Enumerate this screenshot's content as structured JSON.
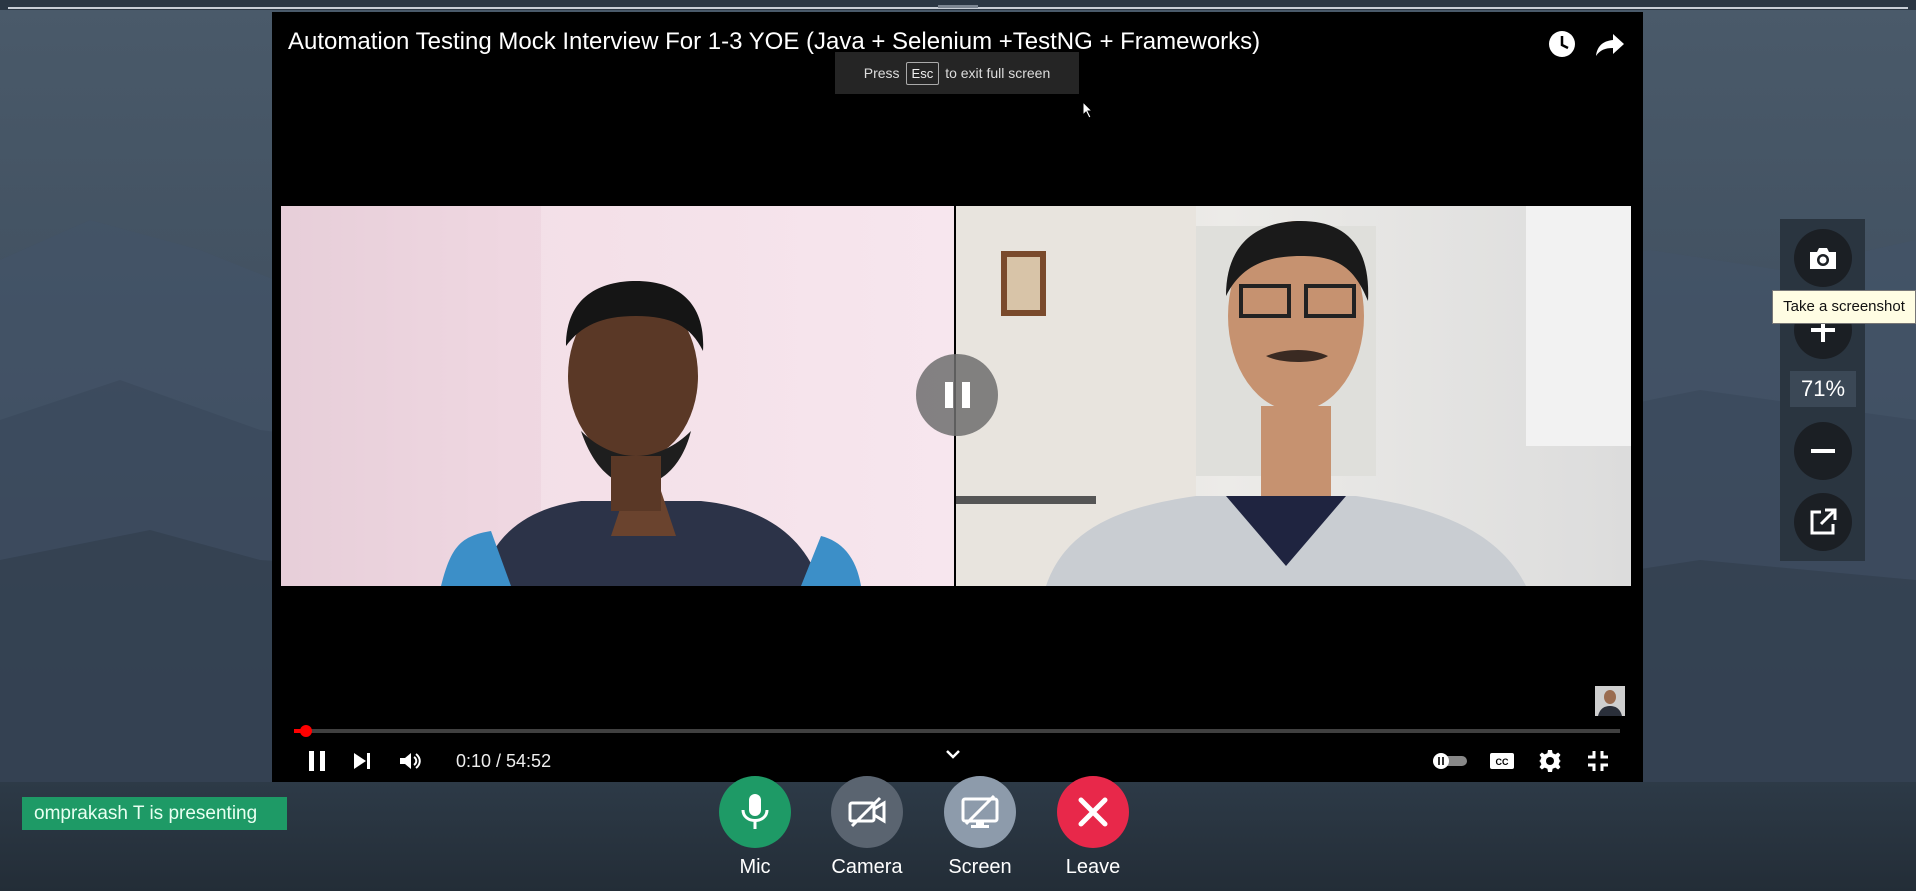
{
  "video": {
    "title": "Automation Testing Mock Interview For 1-3 YOE (Java + Selenium +TestNG + Frameworks)",
    "esc_press": "Press",
    "esc_key": "Esc",
    "esc_suffix": "to exit full screen",
    "time": "0:10 / 54:52",
    "progress_fraction": 0.003
  },
  "toolbar": {
    "zoom_level": "71%",
    "tooltip": "Take a screenshot"
  },
  "call": {
    "presenting_text": "omprakash T is presenting",
    "buttons": [
      {
        "label": "Mic",
        "color": "#1e9a66"
      },
      {
        "label": "Camera",
        "color": "#5a6470"
      },
      {
        "label": "Screen",
        "color": "#8d9bab"
      },
      {
        "label": "Leave",
        "color": "#e8284a"
      }
    ]
  },
  "colors": {
    "accent_green": "#1e9a66",
    "leave_red": "#e8284a",
    "progress_red": "#ff0000"
  }
}
